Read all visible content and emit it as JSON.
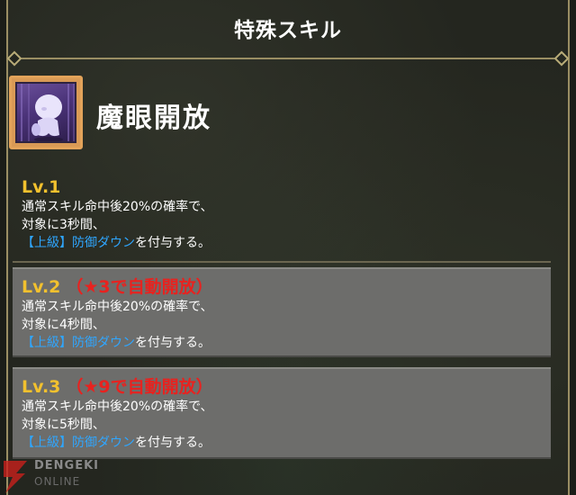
{
  "panel": {
    "title": "特殊スキル"
  },
  "skill": {
    "icon": "ghost-silhouette-icon",
    "name": "魔眼開放"
  },
  "levels": [
    {
      "label": "Lv.1",
      "condition": "",
      "line1": "通常スキル命中後20%の確率で、",
      "line2": "対象に3秒間、",
      "effect_tag": "【上級】防御ダウン",
      "effect_suffix": "を付与する。",
      "locked": false
    },
    {
      "label": "Lv.2",
      "condition": "（★3で自動開放）",
      "line1": "通常スキル命中後20%の確率で、",
      "line2": "対象に4秒間、",
      "effect_tag": "【上級】防御ダウン",
      "effect_suffix": "を付与する。",
      "locked": true
    },
    {
      "label": "Lv.3",
      "condition": "（★9で自動開放）",
      "line1": "通常スキル命中後20%の確率で、",
      "line2": "対象に5秒間、",
      "effect_tag": "【上級】防御ダウン",
      "effect_suffix": "を付与する。",
      "locked": true
    }
  ],
  "watermark": {
    "logo": "dengeki-lightning-logo",
    "text": "DENGEKI",
    "sub": "ONLINE"
  },
  "colors": {
    "level_label": "#f2c12e",
    "unlock_condition": "#e8221f",
    "effect_highlight": "#2fa6ff",
    "frame_gold": "#9a8e63",
    "locked_bg": "#6d6d6b"
  }
}
